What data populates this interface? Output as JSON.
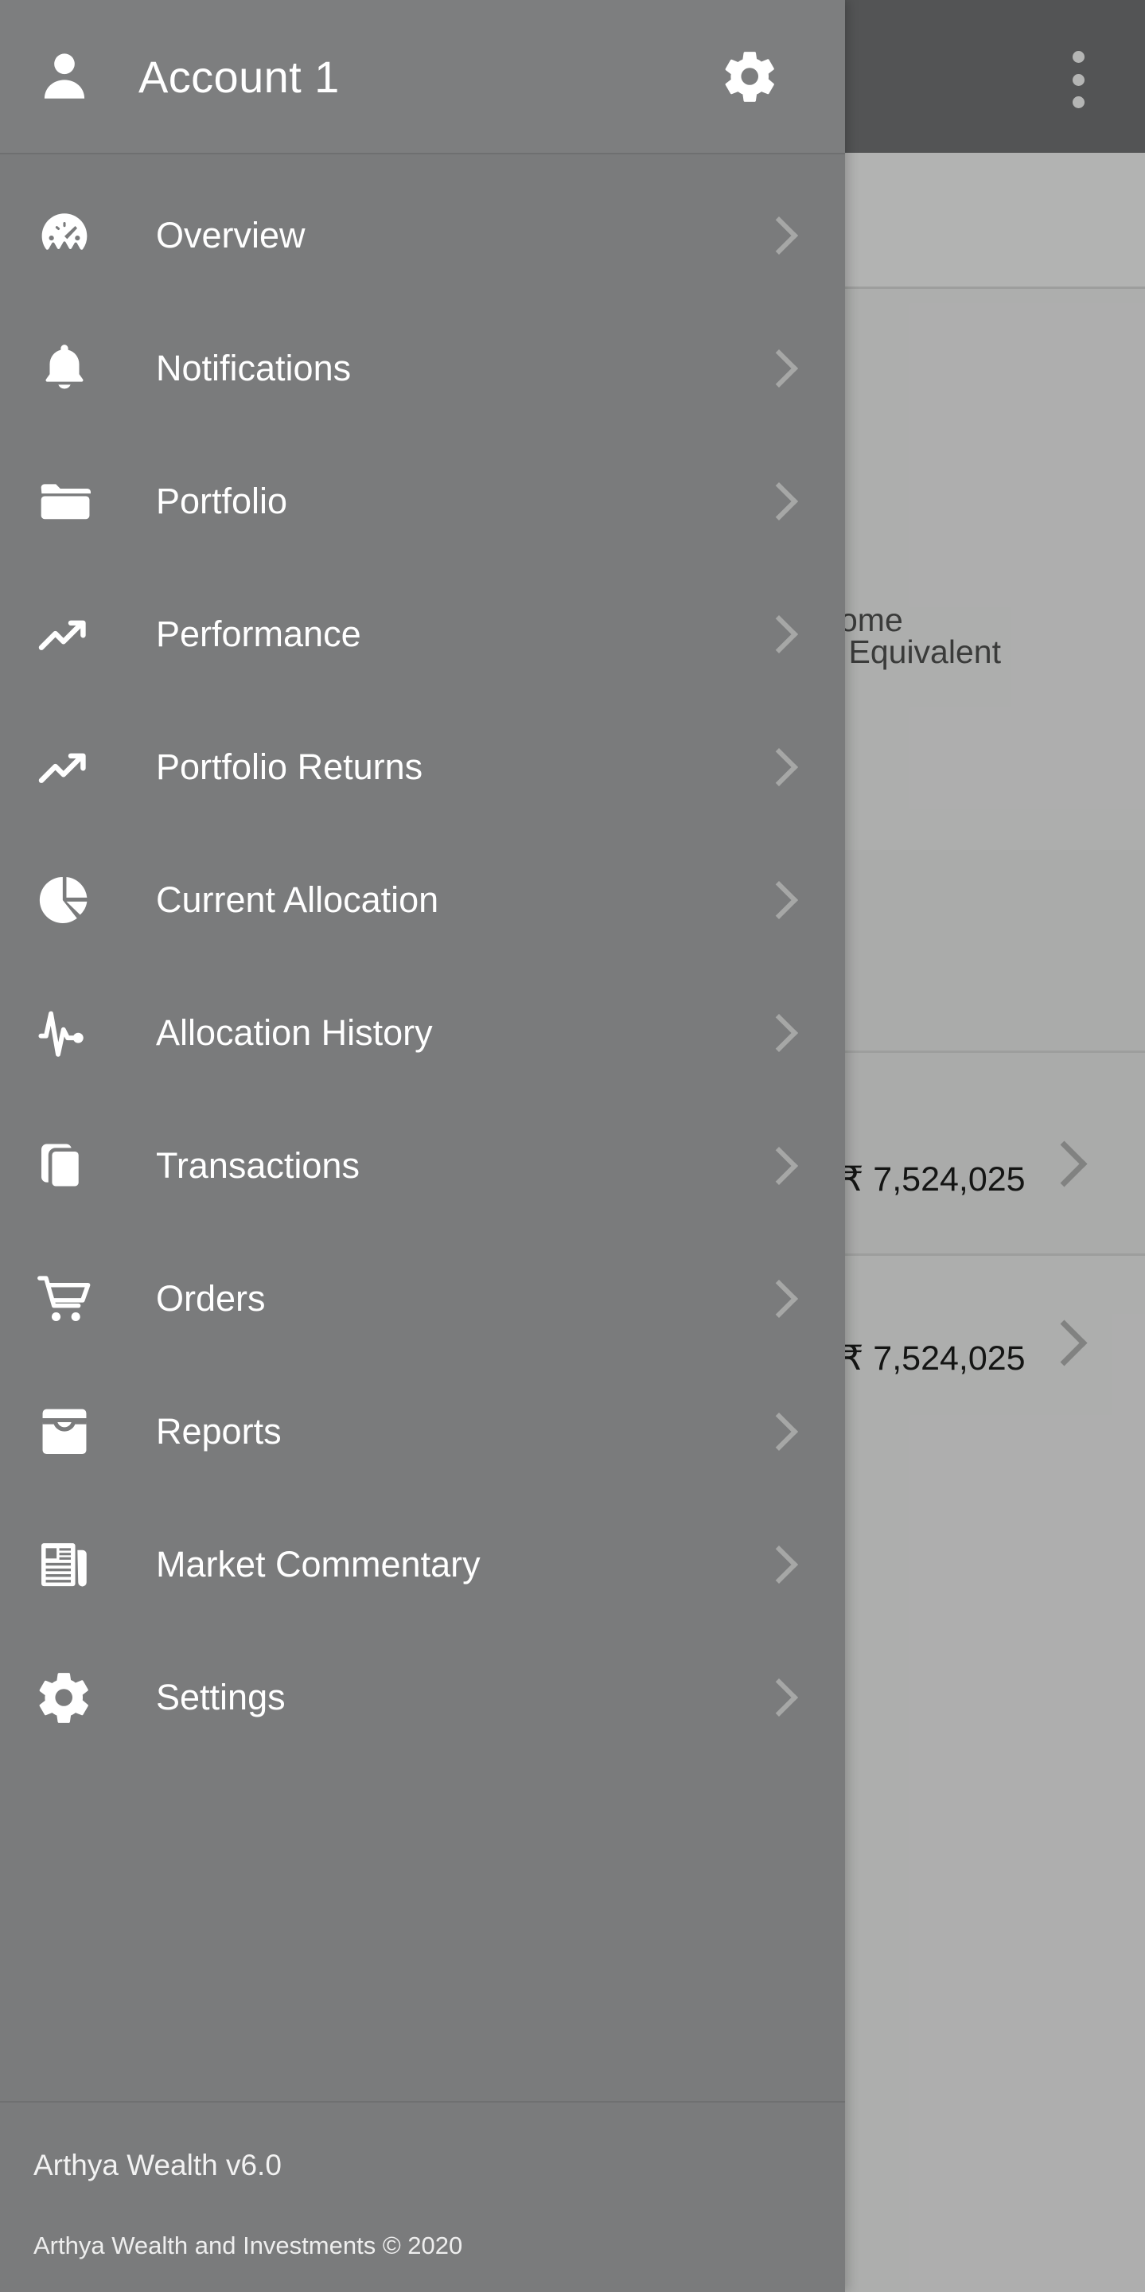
{
  "drawer": {
    "header": {
      "avatar_icon": "person-icon",
      "title": "Account 1",
      "gear_icon": "gear-icon"
    },
    "items": [
      {
        "label": "Overview",
        "icon": "speedometer-icon",
        "chevron": "chevron-right-icon"
      },
      {
        "label": "Notifications",
        "icon": "bell-icon",
        "chevron": "chevron-right-icon"
      },
      {
        "label": "Portfolio",
        "icon": "folder-icon",
        "chevron": "chevron-right-icon"
      },
      {
        "label": "Performance",
        "icon": "trending-up-icon",
        "chevron": "chevron-right-icon"
      },
      {
        "label": "Portfolio Returns",
        "icon": "trending-up-icon",
        "chevron": "chevron-right-icon"
      },
      {
        "label": "Current Allocation",
        "icon": "pie-chart-icon",
        "chevron": "chevron-right-icon"
      },
      {
        "label": "Allocation History",
        "icon": "pulse-icon",
        "chevron": "chevron-right-icon"
      },
      {
        "label": "Transactions",
        "icon": "cards-stack-icon",
        "chevron": "chevron-right-icon"
      },
      {
        "label": "Orders",
        "icon": "shopping-cart-icon",
        "chevron": "chevron-right-icon"
      },
      {
        "label": "Reports",
        "icon": "inbox-tray-icon",
        "chevron": "chevron-right-icon"
      },
      {
        "label": "Market Commentary",
        "icon": "newspaper-icon",
        "chevron": "chevron-right-icon"
      },
      {
        "label": "Settings",
        "icon": "gear-icon",
        "chevron": "chevron-right-icon"
      }
    ],
    "footer": {
      "version": "Arthya Wealth v6.0",
      "copyright": "Arthya Wealth and Investments © 2020"
    }
  },
  "background": {
    "appbar": {
      "overflow_icon": "overflow-menu-icon"
    },
    "labels": [
      {
        "text": "ome"
      },
      {
        "text": "l Equivalent"
      }
    ],
    "rows": [
      {
        "amount": "₹ 7,524,025",
        "chevron": "chevron-right-icon"
      },
      {
        "amount": "₹ 7,524,025",
        "chevron": "chevron-right-icon"
      }
    ]
  },
  "colors": {
    "drawer_bg": "#7a7b7c",
    "drawer_header_bg": "#7d7e7f",
    "appbar_bg": "#595a5c",
    "content_bg": "#c0c1c0",
    "text_on_drawer": "#ffffff",
    "chevron": "#a6a7a6"
  }
}
